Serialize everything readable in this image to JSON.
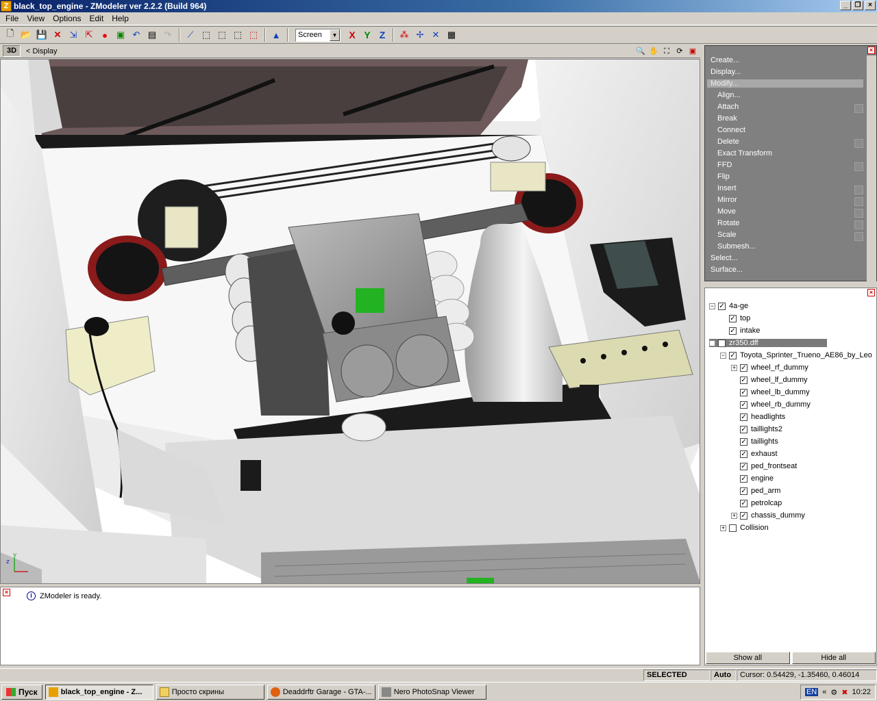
{
  "window": {
    "title": "black_top_engine - ZModeler ver 2.2.2 (Build 964)",
    "app_icon": "Z"
  },
  "menu": [
    "File",
    "View",
    "Options",
    "Edit",
    "Help"
  ],
  "toolbar": {
    "screen_select": "Screen",
    "axis_x": "X",
    "axis_y": "Y",
    "axis_z": "Z"
  },
  "viewport": {
    "mode_tag": "3D",
    "breadcrumb": "< Display"
  },
  "commands": {
    "items": [
      {
        "label": "Create...",
        "level": 0
      },
      {
        "label": "Display...",
        "level": 0
      },
      {
        "label": "Modify...",
        "level": 0,
        "active": true
      },
      {
        "label": "Align...",
        "level": 1
      },
      {
        "label": "Attach",
        "level": 1,
        "check": true
      },
      {
        "label": "Break",
        "level": 1
      },
      {
        "label": "Connect",
        "level": 1
      },
      {
        "label": "Delete",
        "level": 1,
        "check": true
      },
      {
        "label": "Exact Transform",
        "level": 1
      },
      {
        "label": "FFD",
        "level": 1,
        "check": true
      },
      {
        "label": "Flip",
        "level": 1
      },
      {
        "label": "Insert",
        "level": 1,
        "check": true
      },
      {
        "label": "Mirror",
        "level": 1,
        "check": true
      },
      {
        "label": "Move",
        "level": 1,
        "check": true
      },
      {
        "label": "Rotate",
        "level": 1,
        "check": true
      },
      {
        "label": "Scale",
        "level": 1,
        "check": true
      },
      {
        "label": "Submesh...",
        "level": 1
      },
      {
        "label": "Select...",
        "level": 0
      },
      {
        "label": "Surface...",
        "level": 0
      }
    ]
  },
  "tree": {
    "nodes": [
      {
        "label": "4a-ge",
        "depth": 0,
        "expander": "−",
        "checked": true
      },
      {
        "label": "top",
        "depth": 1,
        "checked": true
      },
      {
        "label": "intake",
        "depth": 1,
        "checked": true
      },
      {
        "label": "zr350.dff",
        "depth": 0,
        "expander": "−",
        "checked": true,
        "selected": true
      },
      {
        "label": "Toyota_Sprinter_Trueno_AE86_by_Leo",
        "depth": 1,
        "expander": "−",
        "checked": true
      },
      {
        "label": "wheel_rf_dummy",
        "depth": 2,
        "expander": "+",
        "checked": true
      },
      {
        "label": "wheel_lf_dummy",
        "depth": 2,
        "checked": true
      },
      {
        "label": "wheel_lb_dummy",
        "depth": 2,
        "checked": true
      },
      {
        "label": "wheel_rb_dummy",
        "depth": 2,
        "checked": true
      },
      {
        "label": "headlights",
        "depth": 2,
        "checked": true
      },
      {
        "label": "taillights2",
        "depth": 2,
        "checked": true
      },
      {
        "label": "taillights",
        "depth": 2,
        "checked": true
      },
      {
        "label": "exhaust",
        "depth": 2,
        "checked": true
      },
      {
        "label": "ped_frontseat",
        "depth": 2,
        "checked": true
      },
      {
        "label": "engine",
        "depth": 2,
        "checked": true
      },
      {
        "label": "ped_arm",
        "depth": 2,
        "checked": true
      },
      {
        "label": "petrolcap",
        "depth": 2,
        "checked": true
      },
      {
        "label": "chassis_dummy",
        "depth": 2,
        "expander": "+",
        "checked": true
      },
      {
        "label": "Collision",
        "depth": 1,
        "expander": "+",
        "checked": false
      }
    ],
    "show_all": "Show all",
    "hide_all": "Hide all"
  },
  "log": {
    "message": "ZModeler is ready."
  },
  "status": {
    "mode": "SELECTED MODE",
    "auto": "Auto",
    "cursor": "Cursor: 0.54429, -1.35460, 0.46014"
  },
  "taskbar": {
    "start": "Пуск",
    "tasks": [
      "black_top_engine - Z...",
      "Просто скрины",
      "Deaddrftr Garage - GTA-...",
      "Nero PhotoSnap Viewer"
    ],
    "lang": "EN",
    "time": "10:22"
  },
  "colors": {
    "title_start": "#0a246a",
    "command_bg": "#808080",
    "accent_red": "#cc0000"
  }
}
